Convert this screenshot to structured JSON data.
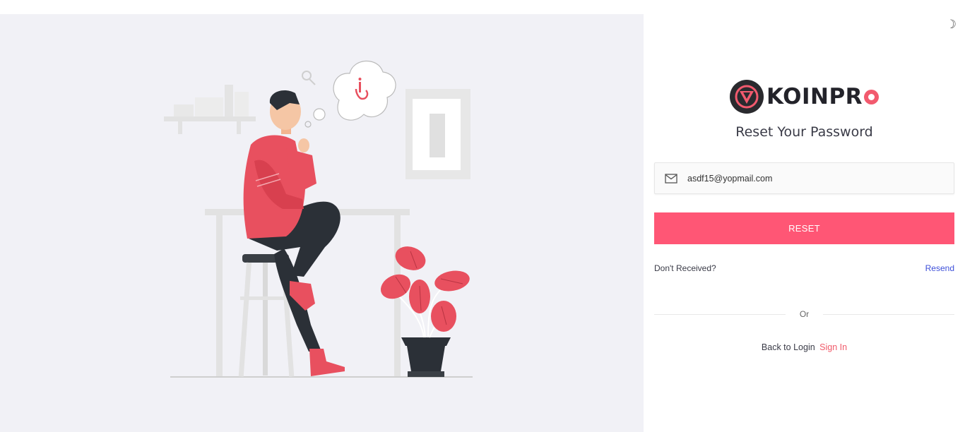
{
  "brand": {
    "name_prefix": "KOINPR",
    "accent": "#f25a6e",
    "logo_icon": "koinpro-logo-icon"
  },
  "theme_toggle": {
    "icon": "moon-icon",
    "glyph": "☽"
  },
  "form": {
    "title": "Reset Your Password",
    "email": {
      "icon": "mail-icon",
      "value": "asdf15@yopmail.com"
    },
    "reset_label": "RESET",
    "reset_color": "#ff5675",
    "dont_received": "Don't Received?",
    "resend_label": "Resend",
    "divider_label": "Or",
    "back_text": "Back to Login",
    "signin_label": "Sign In"
  },
  "illustration": {
    "icon": "person-thinking-illustration"
  }
}
